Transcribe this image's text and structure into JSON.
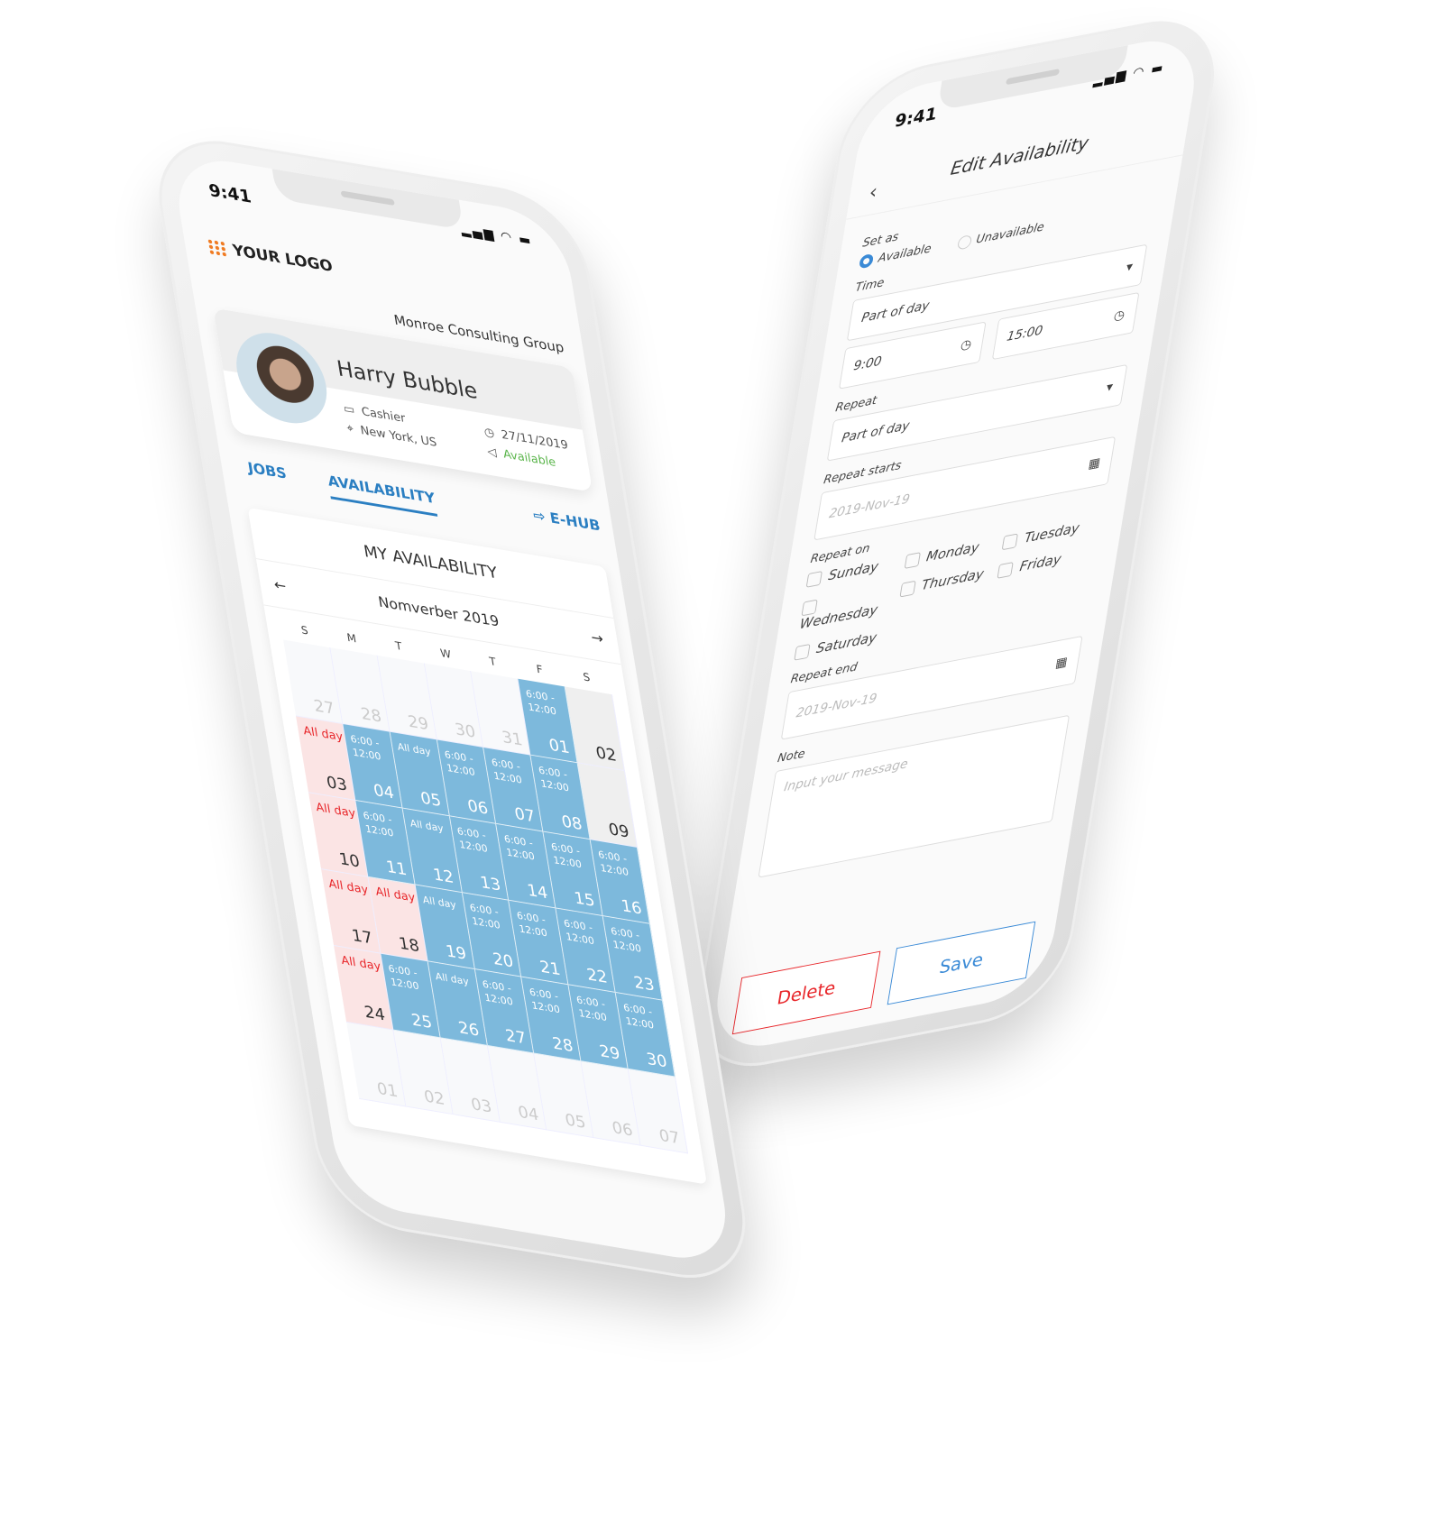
{
  "left_phone": {
    "status_time": "9:41",
    "logo": "YOUR LOGO",
    "company": "Monroe Consulting Group",
    "profile": {
      "name": "Harry Bubble",
      "role": "Cashier",
      "location": "New York, US",
      "date": "27/11/2019",
      "status": "Available"
    },
    "tabs": [
      {
        "label": "JOBS"
      },
      {
        "label": "AVAILABILITY",
        "active": true
      },
      {
        "label": "E-HUB"
      }
    ],
    "availability": {
      "title": "MY AVAILABILITY",
      "month": "Nomverber 2019",
      "weekdays": [
        "S",
        "M",
        "T",
        "W",
        "T",
        "F",
        "S"
      ],
      "days": [
        {
          "d": "27",
          "type": "other"
        },
        {
          "d": "28",
          "type": "other"
        },
        {
          "d": "29",
          "type": "other"
        },
        {
          "d": "30",
          "type": "other"
        },
        {
          "d": "31",
          "type": "other"
        },
        {
          "d": "01",
          "type": "blue",
          "label": "6:00 - 12:00"
        },
        {
          "d": "02",
          "type": "grey"
        },
        {
          "d": "03",
          "type": "pink",
          "label": "All day"
        },
        {
          "d": "04",
          "type": "blue",
          "label": "6:00 - 12:00"
        },
        {
          "d": "05",
          "type": "blue",
          "label": "All day"
        },
        {
          "d": "06",
          "type": "blue",
          "label": "6:00 - 12:00"
        },
        {
          "d": "07",
          "type": "blue",
          "label": "6:00 - 12:00"
        },
        {
          "d": "08",
          "type": "blue",
          "label": "6:00 - 12:00"
        },
        {
          "d": "09",
          "type": "grey"
        },
        {
          "d": "10",
          "type": "pink",
          "label": "All day"
        },
        {
          "d": "11",
          "type": "blue",
          "label": "6:00 - 12:00"
        },
        {
          "d": "12",
          "type": "blue",
          "label": "All day"
        },
        {
          "d": "13",
          "type": "blue",
          "label": "6:00 - 12:00"
        },
        {
          "d": "14",
          "type": "blue",
          "label": "6:00 - 12:00"
        },
        {
          "d": "15",
          "type": "blue",
          "label": "6:00 - 12:00"
        },
        {
          "d": "16",
          "type": "blue",
          "label": "6:00 - 12:00"
        },
        {
          "d": "17",
          "type": "pink",
          "label": "All day"
        },
        {
          "d": "18",
          "type": "pink",
          "label": "All day"
        },
        {
          "d": "19",
          "type": "blue",
          "label": "All day"
        },
        {
          "d": "20",
          "type": "blue",
          "label": "6:00 - 12:00"
        },
        {
          "d": "21",
          "type": "blue",
          "label": "6:00 - 12:00"
        },
        {
          "d": "22",
          "type": "blue",
          "label": "6:00 - 12:00"
        },
        {
          "d": "23",
          "type": "blue",
          "label": "6:00 - 12:00"
        },
        {
          "d": "24",
          "type": "pink",
          "label": "All day"
        },
        {
          "d": "25",
          "type": "blue",
          "label": "6:00 - 12:00"
        },
        {
          "d": "26",
          "type": "blue",
          "label": "All day"
        },
        {
          "d": "27",
          "type": "blue",
          "label": "6:00 - 12:00"
        },
        {
          "d": "28",
          "type": "blue",
          "label": "6:00 - 12:00"
        },
        {
          "d": "29",
          "type": "blue",
          "label": "6:00 - 12:00"
        },
        {
          "d": "30",
          "type": "blue",
          "label": "6:00 - 12:00"
        },
        {
          "d": "01",
          "type": "other"
        },
        {
          "d": "02",
          "type": "other"
        },
        {
          "d": "03",
          "type": "other"
        },
        {
          "d": "04",
          "type": "other"
        },
        {
          "d": "05",
          "type": "other"
        },
        {
          "d": "06",
          "type": "other"
        },
        {
          "d": "07",
          "type": "other"
        }
      ]
    }
  },
  "right_phone": {
    "status_time": "9:41",
    "title": "Edit Availability",
    "set_as_label": "Set as",
    "available": "Available",
    "unavailable": "Unavailable",
    "time_label": "Time",
    "time_value": "Part of day",
    "start_time": "9:00",
    "end_time": "15:00",
    "repeat_label": "Repeat",
    "repeat_value": "Part of day",
    "repeat_starts_label": "Repeat starts",
    "repeat_starts_placeholder": "2019-Nov-19",
    "repeat_on_label": "Repeat on",
    "weekdays": [
      "Sunday",
      "Monday",
      "Tuesday",
      "Wednesday",
      "Thursday",
      "Friday",
      "Saturday"
    ],
    "repeat_end_label": "Repeat end",
    "repeat_end_placeholder": "2019-Nov-19",
    "note_label": "Note",
    "note_placeholder": "Input your message",
    "delete_label": "Delete",
    "save_label": "Save"
  },
  "colors": {
    "accent": "#2b7fc2",
    "available_block": "#7db9dc",
    "unavailable_block": "#fbe4e4",
    "unavailable_text": "#e8262a",
    "status_green": "#5ab54b",
    "logo_orange": "#f07b22"
  }
}
